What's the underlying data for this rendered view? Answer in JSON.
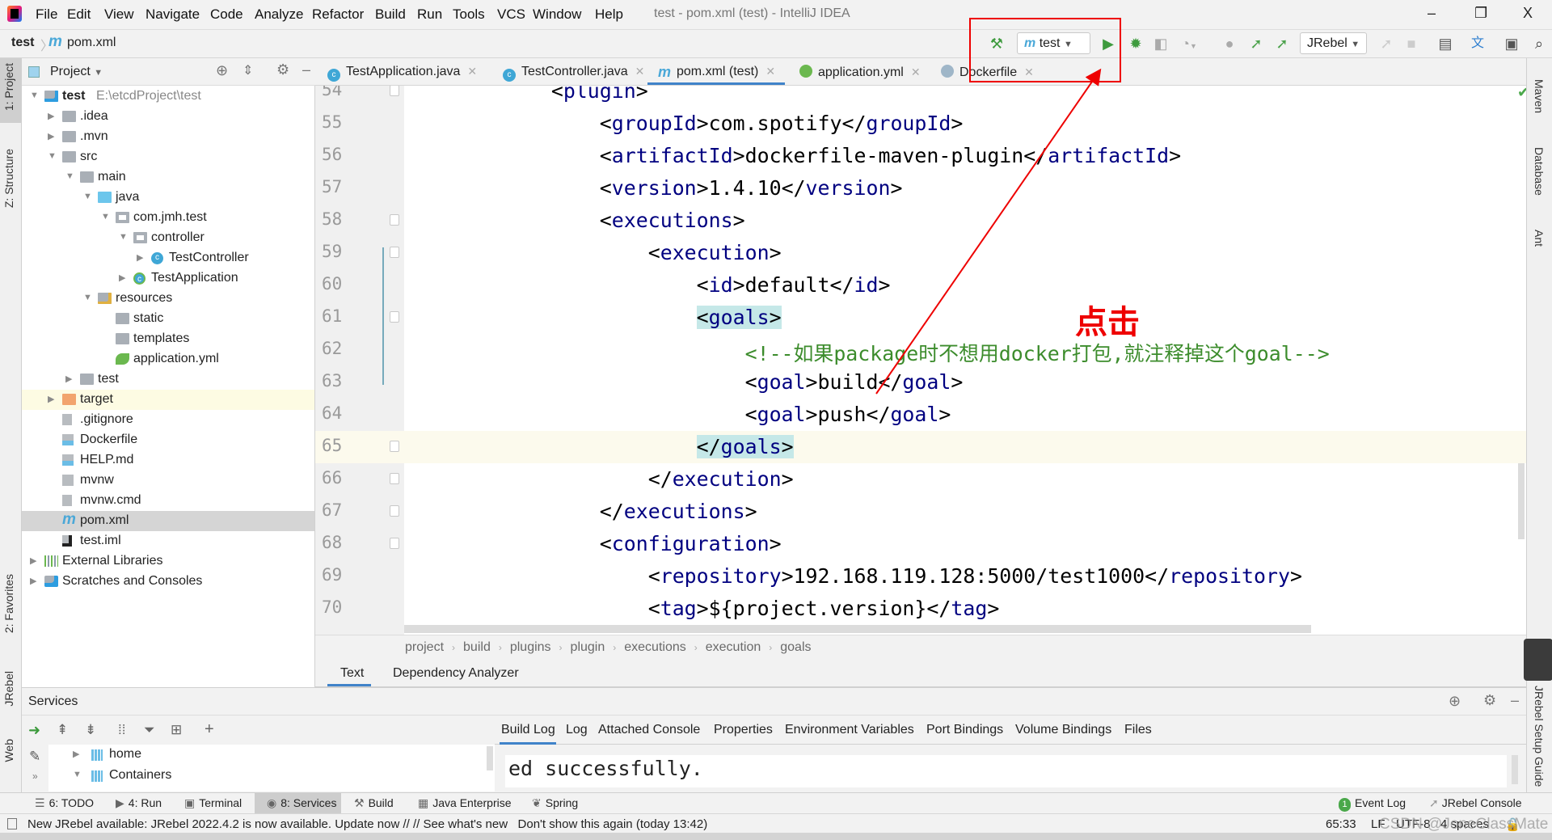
{
  "window": {
    "title": "test - pom.xml (test) - IntelliJ IDEA",
    "minimize": "–",
    "maximize": "❐",
    "close": "X"
  },
  "menu": [
    "File",
    "Edit",
    "View",
    "Navigate",
    "Code",
    "Analyze",
    "Refactor",
    "Build",
    "Run",
    "Tools",
    "VCS",
    "Window",
    "Help"
  ],
  "navbar": {
    "project": "test",
    "file": "pom.xml"
  },
  "toolbar": {
    "run_config": "test",
    "jrebel_select": "JRebel"
  },
  "left_strip": [
    "1: Project",
    "Z: Structure",
    "2: Favorites",
    "JRebel",
    "Web"
  ],
  "right_strip": [
    "Maven",
    "Database",
    "Ant",
    "JRebel Setup Guide"
  ],
  "project_panel": {
    "title": "Project"
  },
  "tree": [
    {
      "label": "test",
      "path": "E:\\etcdProject\\test",
      "level": 0,
      "arrow": "down",
      "icon": "module-folder"
    },
    {
      "label": ".idea",
      "level": 1,
      "arrow": "right",
      "icon": "folder"
    },
    {
      "label": ".mvn",
      "level": 1,
      "arrow": "right",
      "icon": "folder"
    },
    {
      "label": "src",
      "level": 1,
      "arrow": "down",
      "icon": "folder"
    },
    {
      "label": "main",
      "level": 2,
      "arrow": "down",
      "icon": "folder"
    },
    {
      "label": "java",
      "level": 3,
      "arrow": "down",
      "icon": "source-folder"
    },
    {
      "label": "com.jmh.test",
      "level": 4,
      "arrow": "down",
      "icon": "package"
    },
    {
      "label": "controller",
      "level": 5,
      "arrow": "down",
      "icon": "package"
    },
    {
      "label": "TestController",
      "level": 6,
      "arrow": "right",
      "icon": "class"
    },
    {
      "label": "TestApplication",
      "level": 5,
      "arrow": "right",
      "icon": "spring-boot-class"
    },
    {
      "label": "resources",
      "level": 3,
      "arrow": "down",
      "icon": "resources-folder"
    },
    {
      "label": "static",
      "level": 4,
      "arrow": "",
      "icon": "folder"
    },
    {
      "label": "templates",
      "level": 4,
      "arrow": "",
      "icon": "folder"
    },
    {
      "label": "application.yml",
      "level": 4,
      "arrow": "",
      "icon": "spring-yml"
    },
    {
      "label": "test",
      "level": 2,
      "arrow": "right",
      "icon": "folder"
    },
    {
      "label": "target",
      "level": 1,
      "arrow": "right",
      "icon": "excluded-folder",
      "highlight": "#fdfbe3"
    },
    {
      "label": ".gitignore",
      "level": 1,
      "arrow": "",
      "icon": "ignore-file"
    },
    {
      "label": "Dockerfile",
      "level": 1,
      "arrow": "",
      "icon": "docker-file"
    },
    {
      "label": "HELP.md",
      "level": 1,
      "arrow": "",
      "icon": "markdown-file"
    },
    {
      "label": "mvnw",
      "level": 1,
      "arrow": "",
      "icon": "shell-file"
    },
    {
      "label": "mvnw.cmd",
      "level": 1,
      "arrow": "",
      "icon": "text-file"
    },
    {
      "label": "pom.xml",
      "level": 1,
      "arrow": "",
      "icon": "maven-file",
      "selected": true
    },
    {
      "label": "test.iml",
      "level": 1,
      "arrow": "",
      "icon": "iml-file"
    },
    {
      "label": "External Libraries",
      "level": 0,
      "arrow": "right",
      "icon": "libraries"
    },
    {
      "label": "Scratches and Consoles",
      "level": 0,
      "arrow": "right",
      "icon": "scratches"
    }
  ],
  "editor_tabs": [
    {
      "label": "TestApplication.java",
      "icon": "spring-boot-class"
    },
    {
      "label": "TestController.java",
      "icon": "class"
    },
    {
      "label": "pom.xml (test)",
      "icon": "maven-file",
      "active": true
    },
    {
      "label": "application.yml",
      "icon": "spring-yml"
    },
    {
      "label": "Dockerfile",
      "icon": "docker-file"
    }
  ],
  "editor": {
    "caret_line": 65,
    "lines": [
      {
        "n": 54,
        "text": "            <plugin>",
        "fold": true
      },
      {
        "n": 55,
        "text": "                <groupId>com.spotify</groupId>"
      },
      {
        "n": 56,
        "text": "                <artifactId>dockerfile-maven-plugin</artifactId>"
      },
      {
        "n": 57,
        "text": "                <version>1.4.10</version>"
      },
      {
        "n": 58,
        "text": "                <executions>",
        "fold": true
      },
      {
        "n": 59,
        "text": "                    <execution>",
        "fold": true
      },
      {
        "n": 60,
        "text": "                        <id>default</id>"
      },
      {
        "n": 61,
        "text": "                        <goals>",
        "fold": true,
        "match": true
      },
      {
        "n": 62,
        "text": "                            <!--如果package时不想用docker打包,就注释掉这个goal-->"
      },
      {
        "n": 63,
        "text": "                            <goal>build</goal>"
      },
      {
        "n": 64,
        "text": "                            <goal>push</goal>"
      },
      {
        "n": 65,
        "text": "                        </goals>",
        "fold": true,
        "match": true
      },
      {
        "n": 66,
        "text": "                    </execution>",
        "fold": true
      },
      {
        "n": 67,
        "text": "                </executions>",
        "fold": true
      },
      {
        "n": 68,
        "text": "                <configuration>",
        "fold": true
      },
      {
        "n": 69,
        "text": "                    <repository>192.168.119.128:5000/test1000</repository>"
      },
      {
        "n": 70,
        "text": "                    <tag>${project.version}</tag>"
      }
    ]
  },
  "annotation": {
    "text": "点击",
    "color": "#ee0000"
  },
  "breadcrumbs": [
    "project",
    "build",
    "plugins",
    "plugin",
    "executions",
    "execution",
    "goals"
  ],
  "editor_subtabs": [
    {
      "label": "Text",
      "active": true
    },
    {
      "label": "Dependency Analyzer"
    }
  ],
  "services": {
    "title": "Services",
    "tree": [
      {
        "label": "home",
        "arrow": "right"
      },
      {
        "label": "Containers",
        "arrow": "down"
      }
    ],
    "tabs": [
      "Build Log",
      "Log",
      "Attached Console",
      "Properties",
      "Environment Variables",
      "Port Bindings",
      "Volume Bindings",
      "Files"
    ],
    "active_tab": "Build Log",
    "console_text": "ed successfully."
  },
  "tool_windows_left": [
    {
      "label": "6: TODO",
      "icon": "todo-icon"
    },
    {
      "label": "4: Run",
      "icon": "run-icon"
    },
    {
      "label": "Terminal",
      "icon": "terminal-icon"
    },
    {
      "label": "8: Services",
      "icon": "services-icon",
      "active": true
    },
    {
      "label": "Build",
      "icon": "build-icon"
    },
    {
      "label": "Java Enterprise",
      "icon": "java-enterprise-icon"
    },
    {
      "label": "Spring",
      "icon": "spring-icon"
    }
  ],
  "tool_windows_right": [
    {
      "label": "Event Log",
      "badge": "1"
    },
    {
      "label": "JRebel Console"
    }
  ],
  "status": {
    "message": "New JRebel available: JRebel 2022.4.2 is now available. Update now // // See what's new   Don't show this again (today 13:42)",
    "position": "65:33",
    "line_sep": "LF",
    "encoding": "UTF-8",
    "indent": "4 spaces"
  },
  "watermark": "CSDN @JoneClassMate",
  "colors": {
    "accent": "#4083c9",
    "tag": "#000080",
    "comment": "#3c8c2c",
    "annotation": "#ee0000"
  }
}
